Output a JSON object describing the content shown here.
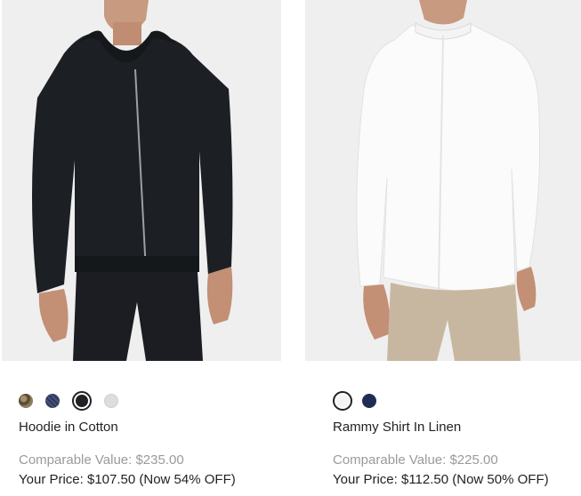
{
  "products": [
    {
      "name": "Hoodie in Cotton",
      "comparable": "Comparable Value: $235.00",
      "price": "Your Price: $107.50 (Now 54% OFF)",
      "image": "black-zip-hoodie-photo",
      "swatches": [
        {
          "color": "camo",
          "hex": "#7a6a4c",
          "selected": false
        },
        {
          "color": "navy-pattern",
          "hex": "#2f3a5a",
          "selected": false
        },
        {
          "color": "black",
          "hex": "#1e2226",
          "selected": true
        },
        {
          "color": "light-grey",
          "hex": "#dddddd",
          "selected": false
        }
      ]
    },
    {
      "name": "Rammy Shirt In Linen",
      "comparable": "Comparable Value: $225.00",
      "price": "Your Price: $112.50 (Now 50% OFF)",
      "image": "white-linen-shirt-photo",
      "swatches": [
        {
          "color": "white",
          "hex": "#f4f4f4",
          "selected": true
        },
        {
          "color": "navy",
          "hex": "#1f2d55",
          "selected": false
        }
      ]
    }
  ]
}
